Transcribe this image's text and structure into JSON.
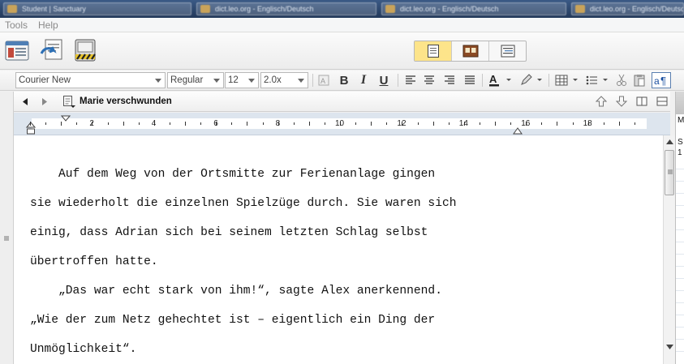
{
  "taskbar": {
    "items": [
      {
        "label": "Student | Sanctuary"
      },
      {
        "label": "dict.leo.org - Englisch/Deutsch"
      },
      {
        "label": "dict.leo.org - Englisch/Deutsch"
      },
      {
        "label": "dict.leo.org - Englisch/Deutsch"
      }
    ]
  },
  "menu": {
    "items": [
      "Tools",
      "Help"
    ]
  },
  "toolbar": {
    "buttons": [
      {
        "icon": "binder-icon"
      },
      {
        "icon": "compose-icon"
      },
      {
        "icon": "edit-scrivenings-icon"
      }
    ],
    "view_modes": [
      {
        "icon": "document-view-icon",
        "active": true
      },
      {
        "icon": "corkboard-view-icon",
        "active": false
      },
      {
        "icon": "outline-view-icon",
        "active": false
      }
    ]
  },
  "format": {
    "font_family": "Courier New",
    "font_style": "Regular",
    "font_size": "12",
    "line_spacing": "2.0x",
    "bold_label": "B",
    "italic_label": "I",
    "underline_label": "U"
  },
  "document": {
    "title": "Marie verschwunden",
    "lines": [
      "    Auf dem Weg von der Ortsmitte zur Ferienanlage gingen",
      "sie wiederholt die einzelnen Spielzüge durch. Sie waren sich",
      "einig, dass Adrian sich bei seinem letzten Schlag selbst",
      "übertroffen hatte.",
      "    „Das war echt stark von ihm!“, sagte Alex anerkennend.",
      "„Wie der zum Netz gehechtet ist – eigentlich ein Ding der",
      "Unmöglichkeit“."
    ]
  },
  "ruler": {
    "labels": [
      "2",
      "4",
      "6",
      "8",
      "10",
      "12",
      "14",
      "16",
      "18"
    ]
  },
  "right_panel": {
    "header": "M",
    "lines": [
      "S",
      "1"
    ]
  },
  "colors": {
    "active_mode": "#fde48a",
    "ruler_bg": "#dde5ee"
  }
}
